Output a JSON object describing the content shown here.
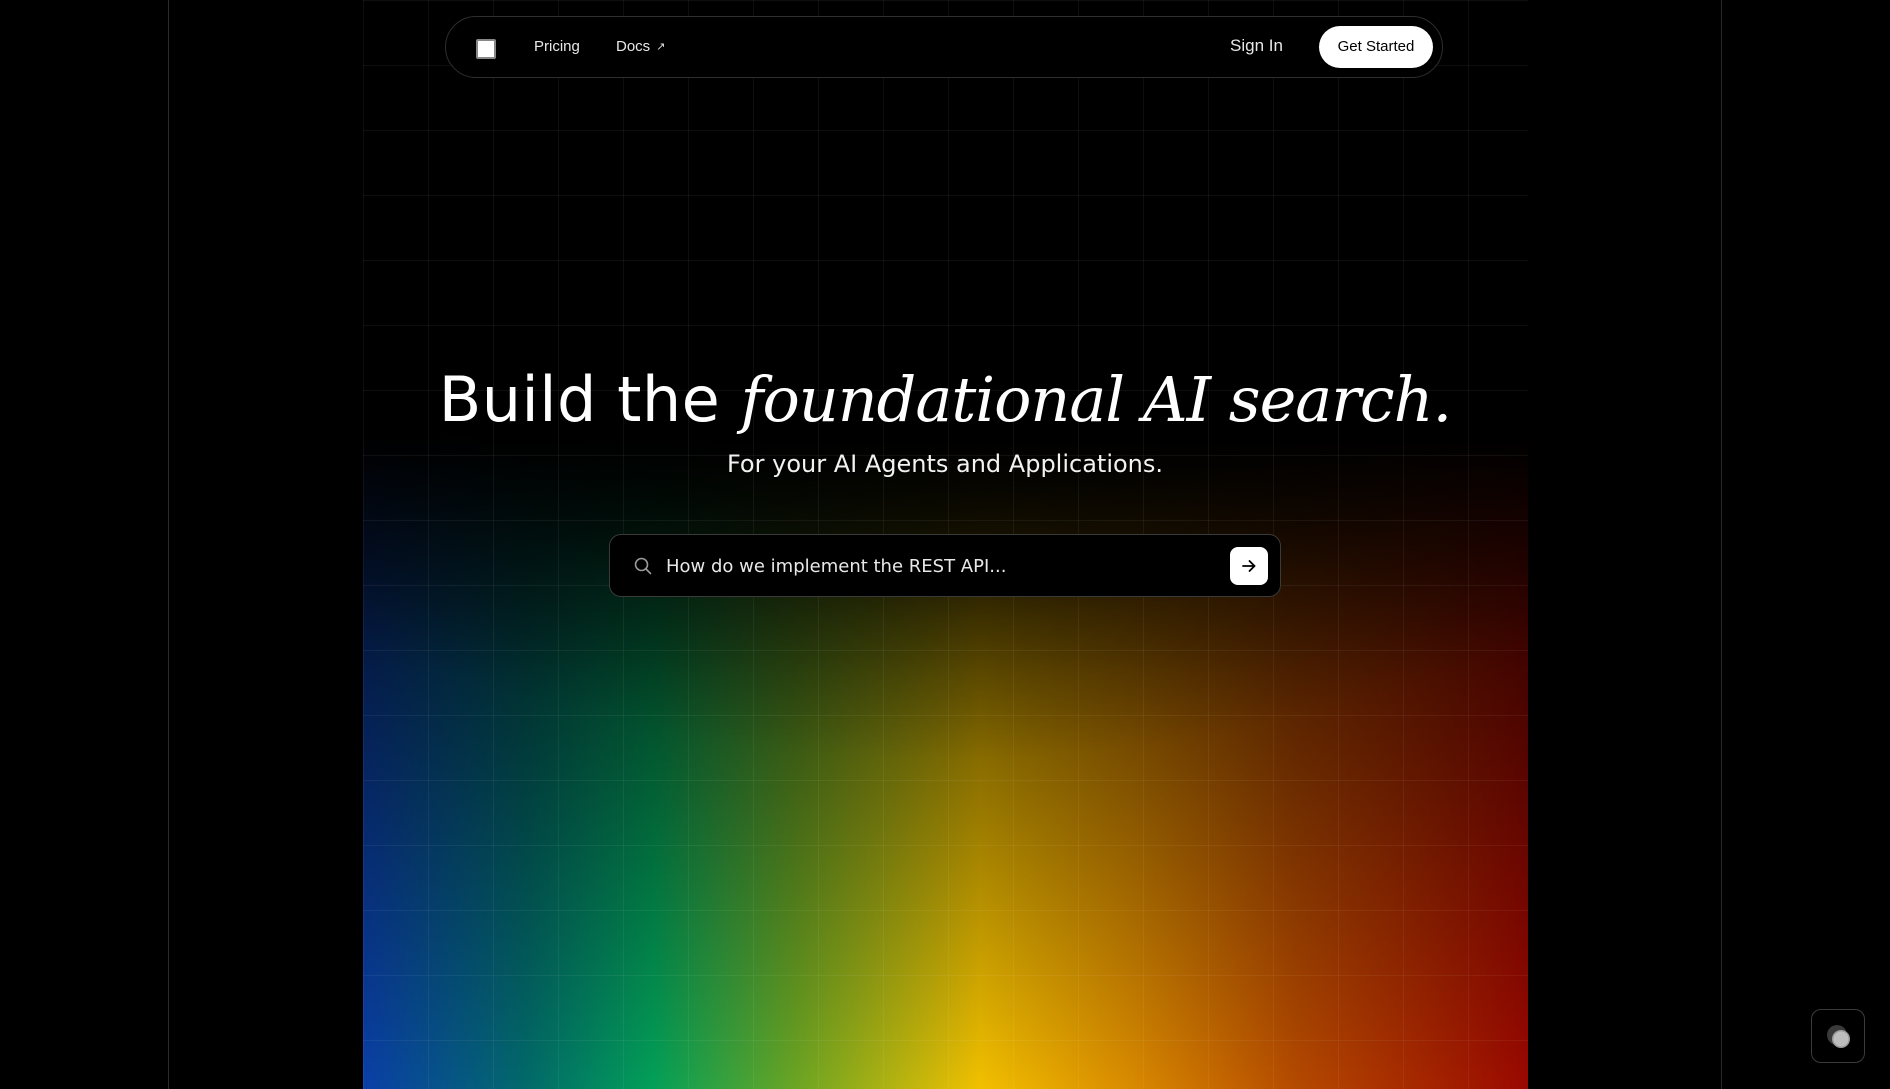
{
  "nav": {
    "links": [
      {
        "label": "Pricing"
      },
      {
        "label": "Docs",
        "icon": "external-arrow-icon",
        "arrow": "↗"
      }
    ],
    "sign_in": "Sign In",
    "get_started": "Get Started"
  },
  "hero": {
    "title_plain": "Build the ",
    "title_italic": "foundational AI search.",
    "subtitle": "For your AI Agents and Applications."
  },
  "search": {
    "placeholder": "How do we implement the REST API..."
  },
  "icons": {
    "logo": "square-logo-icon",
    "search": "search-icon",
    "submit": "arrow-right-icon",
    "chat": "chat-bubble-icon"
  },
  "colors": {
    "background": "#000000",
    "gradient": [
      "#0a3fa8",
      "#03a058",
      "#f2c000",
      "#b54a00",
      "#9a0800"
    ],
    "button": "#ffffff"
  }
}
